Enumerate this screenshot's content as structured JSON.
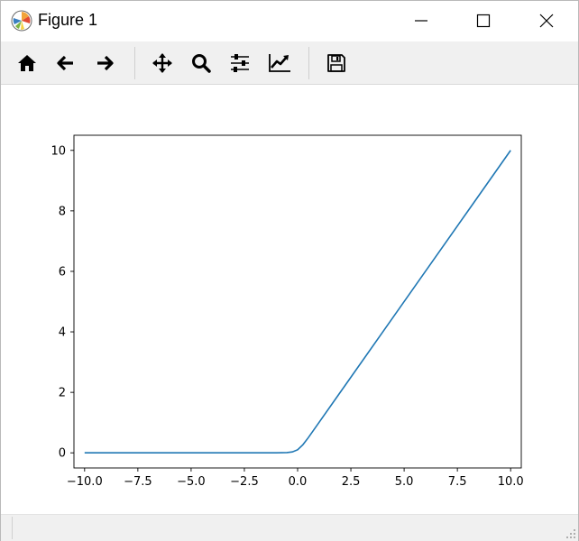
{
  "window": {
    "title": "Figure 1",
    "icons": {
      "app": "matplotlib-logo-icon",
      "minimize": "minimize-icon",
      "maximize": "maximize-icon",
      "close": "close-icon"
    }
  },
  "toolbar": {
    "tools": [
      {
        "name": "home",
        "icon": "home-icon"
      },
      {
        "name": "back",
        "icon": "arrow-left-icon"
      },
      {
        "name": "forward",
        "icon": "arrow-right-icon"
      },
      {
        "name": "pan",
        "icon": "move-icon"
      },
      {
        "name": "zoom",
        "icon": "magnifier-icon"
      },
      {
        "name": "subplots",
        "icon": "sliders-icon"
      },
      {
        "name": "edit-axis",
        "icon": "line-chart-icon"
      },
      {
        "name": "save",
        "icon": "floppy-disk-icon"
      }
    ]
  },
  "chart_data": {
    "type": "line",
    "title": "",
    "xlabel": "",
    "ylabel": "",
    "xlim": [
      -10.5,
      10.5
    ],
    "ylim": [
      -0.5,
      10.5
    ],
    "xticks": [
      -10.0,
      -7.5,
      -5.0,
      -2.5,
      0.0,
      2.5,
      5.0,
      7.5,
      10.0
    ],
    "xtick_labels": [
      "−10.0",
      "−7.5",
      "−5.0",
      "−2.5",
      "0.0",
      "2.5",
      "5.0",
      "7.5",
      "10.0"
    ],
    "yticks": [
      0,
      2,
      4,
      6,
      8,
      10
    ],
    "ytick_labels": [
      "0",
      "2",
      "4",
      "6",
      "8",
      "10"
    ],
    "grid": false,
    "line_color": "#1f77b4",
    "series": [
      {
        "x": [
          -10,
          -8,
          -6,
          -4,
          -2,
          -1,
          -0.5,
          -0.25,
          0,
          0.25,
          0.5,
          1,
          2,
          4,
          6,
          8,
          10
        ],
        "y": [
          0,
          0,
          0,
          0,
          0,
          0.0001,
          0.01,
          0.03,
          0.1,
          0.27,
          0.5,
          1,
          2,
          4,
          6,
          8,
          10
        ]
      }
    ]
  }
}
